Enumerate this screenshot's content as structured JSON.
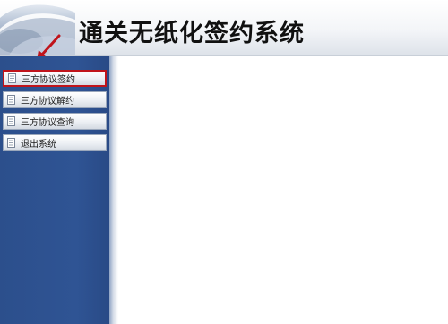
{
  "header": {
    "title": "通关无纸化签约系统"
  },
  "sidebar": {
    "items": [
      {
        "label": "三方协议签约",
        "active": true
      },
      {
        "label": "三方协议解约",
        "active": false
      },
      {
        "label": "三方协议查询",
        "active": false
      },
      {
        "label": "退出系统",
        "active": false
      }
    ]
  },
  "colors": {
    "sidebar_bg": "#2f5494",
    "active_border": "#c0141b",
    "arrow": "#c0141b"
  },
  "icons": {
    "nav_item_icon": "document-icon"
  }
}
